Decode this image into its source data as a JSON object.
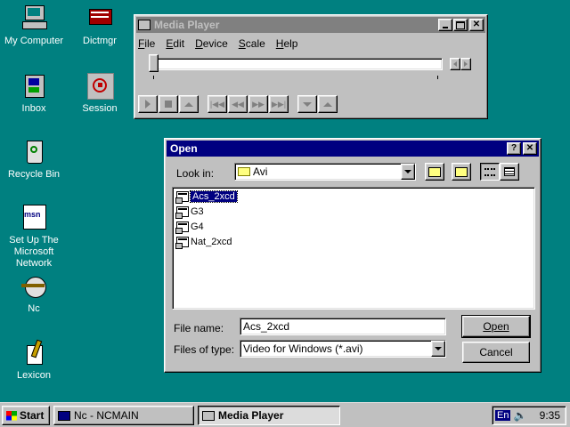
{
  "desktop": {
    "icons": [
      {
        "label": "My Computer"
      },
      {
        "label": "Dictmgr"
      },
      {
        "label": "Inbox"
      },
      {
        "label": "Session"
      },
      {
        "label": "Recycle Bin"
      },
      {
        "label": "Set Up The Microsoft Network"
      },
      {
        "label": "Nc"
      },
      {
        "label": "Lexicon"
      }
    ]
  },
  "media_player": {
    "title": "Media Player",
    "menu": [
      "File",
      "Edit",
      "Device",
      "Scale",
      "Help"
    ]
  },
  "open_dialog": {
    "title": "Open",
    "help_label": "?",
    "close_label": "✕",
    "look_in_label": "Look in:",
    "look_in_value": "Avi",
    "files": [
      "Acs_2xcd",
      "G3",
      "G4",
      "Nat_2xcd"
    ],
    "selected_file": "Acs_2xcd",
    "file_name_label": "File name:",
    "file_name_value": "Acs_2xcd",
    "files_of_type_label": "Files of type:",
    "files_of_type_value": "Video for Windows (*.avi)",
    "open_label": "Open",
    "cancel_label": "Cancel"
  },
  "taskbar": {
    "start_label": "Start",
    "tasks": [
      {
        "label": "Nc - NCMAIN"
      },
      {
        "label": "Media Player"
      }
    ],
    "tray_lang": "En",
    "clock": "9:35"
  }
}
